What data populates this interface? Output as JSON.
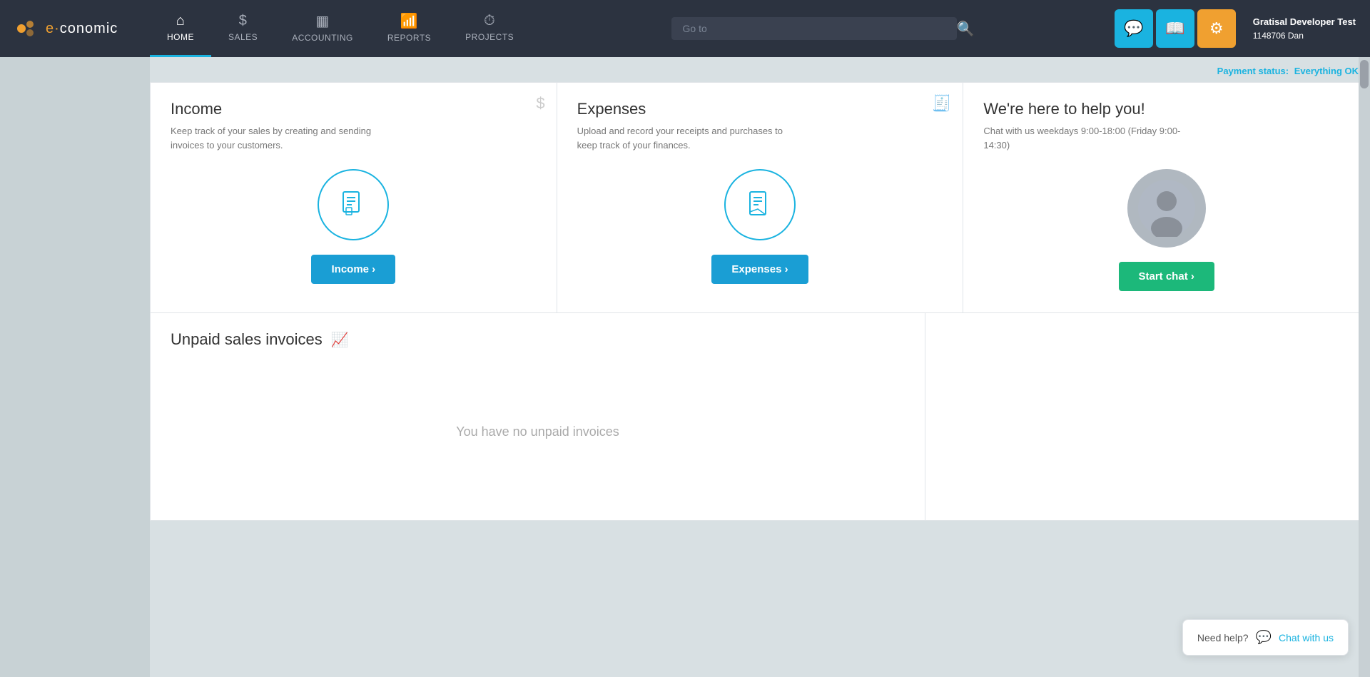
{
  "brand": {
    "logo_prefix": "e·",
    "logo_suffix": "conomic"
  },
  "navbar": {
    "nav_items": [
      {
        "id": "home",
        "label": "HOME",
        "icon": "🏠",
        "active": true
      },
      {
        "id": "sales",
        "label": "SALES",
        "icon": "$",
        "active": false
      },
      {
        "id": "accounting",
        "label": "ACCOUNTING",
        "icon": "🧾",
        "active": false
      },
      {
        "id": "reports",
        "label": "REPORTS",
        "icon": "📊",
        "active": false
      },
      {
        "id": "projects",
        "label": "PROJECTS",
        "icon": "🕐",
        "active": false
      }
    ],
    "search_placeholder": "Go to",
    "user": {
      "company": "Gratisal Developer Test",
      "account": "1148706 Dan"
    }
  },
  "page": {
    "payment_status_label": "Payment status:",
    "payment_status_value": "Everything OK"
  },
  "income_card": {
    "title": "Income",
    "description": "Keep track of your sales by creating and sending invoices to your customers.",
    "button_label": "Income ›"
  },
  "expenses_card": {
    "title": "Expenses",
    "description": "Upload and record your receipts and purchases to keep track of your finances.",
    "button_label": "Expenses ›"
  },
  "help_card": {
    "title": "We're here to help you!",
    "description": "Chat with us weekdays 9:00-18:00 (Friday 9:00-14:30)",
    "button_label": "Start chat ›"
  },
  "unpaid_invoices": {
    "title": "Unpaid sales invoices",
    "empty_message": "You have no unpaid invoices"
  },
  "help_bubble": {
    "label": "Need help?",
    "link_text": "Chat with us"
  }
}
